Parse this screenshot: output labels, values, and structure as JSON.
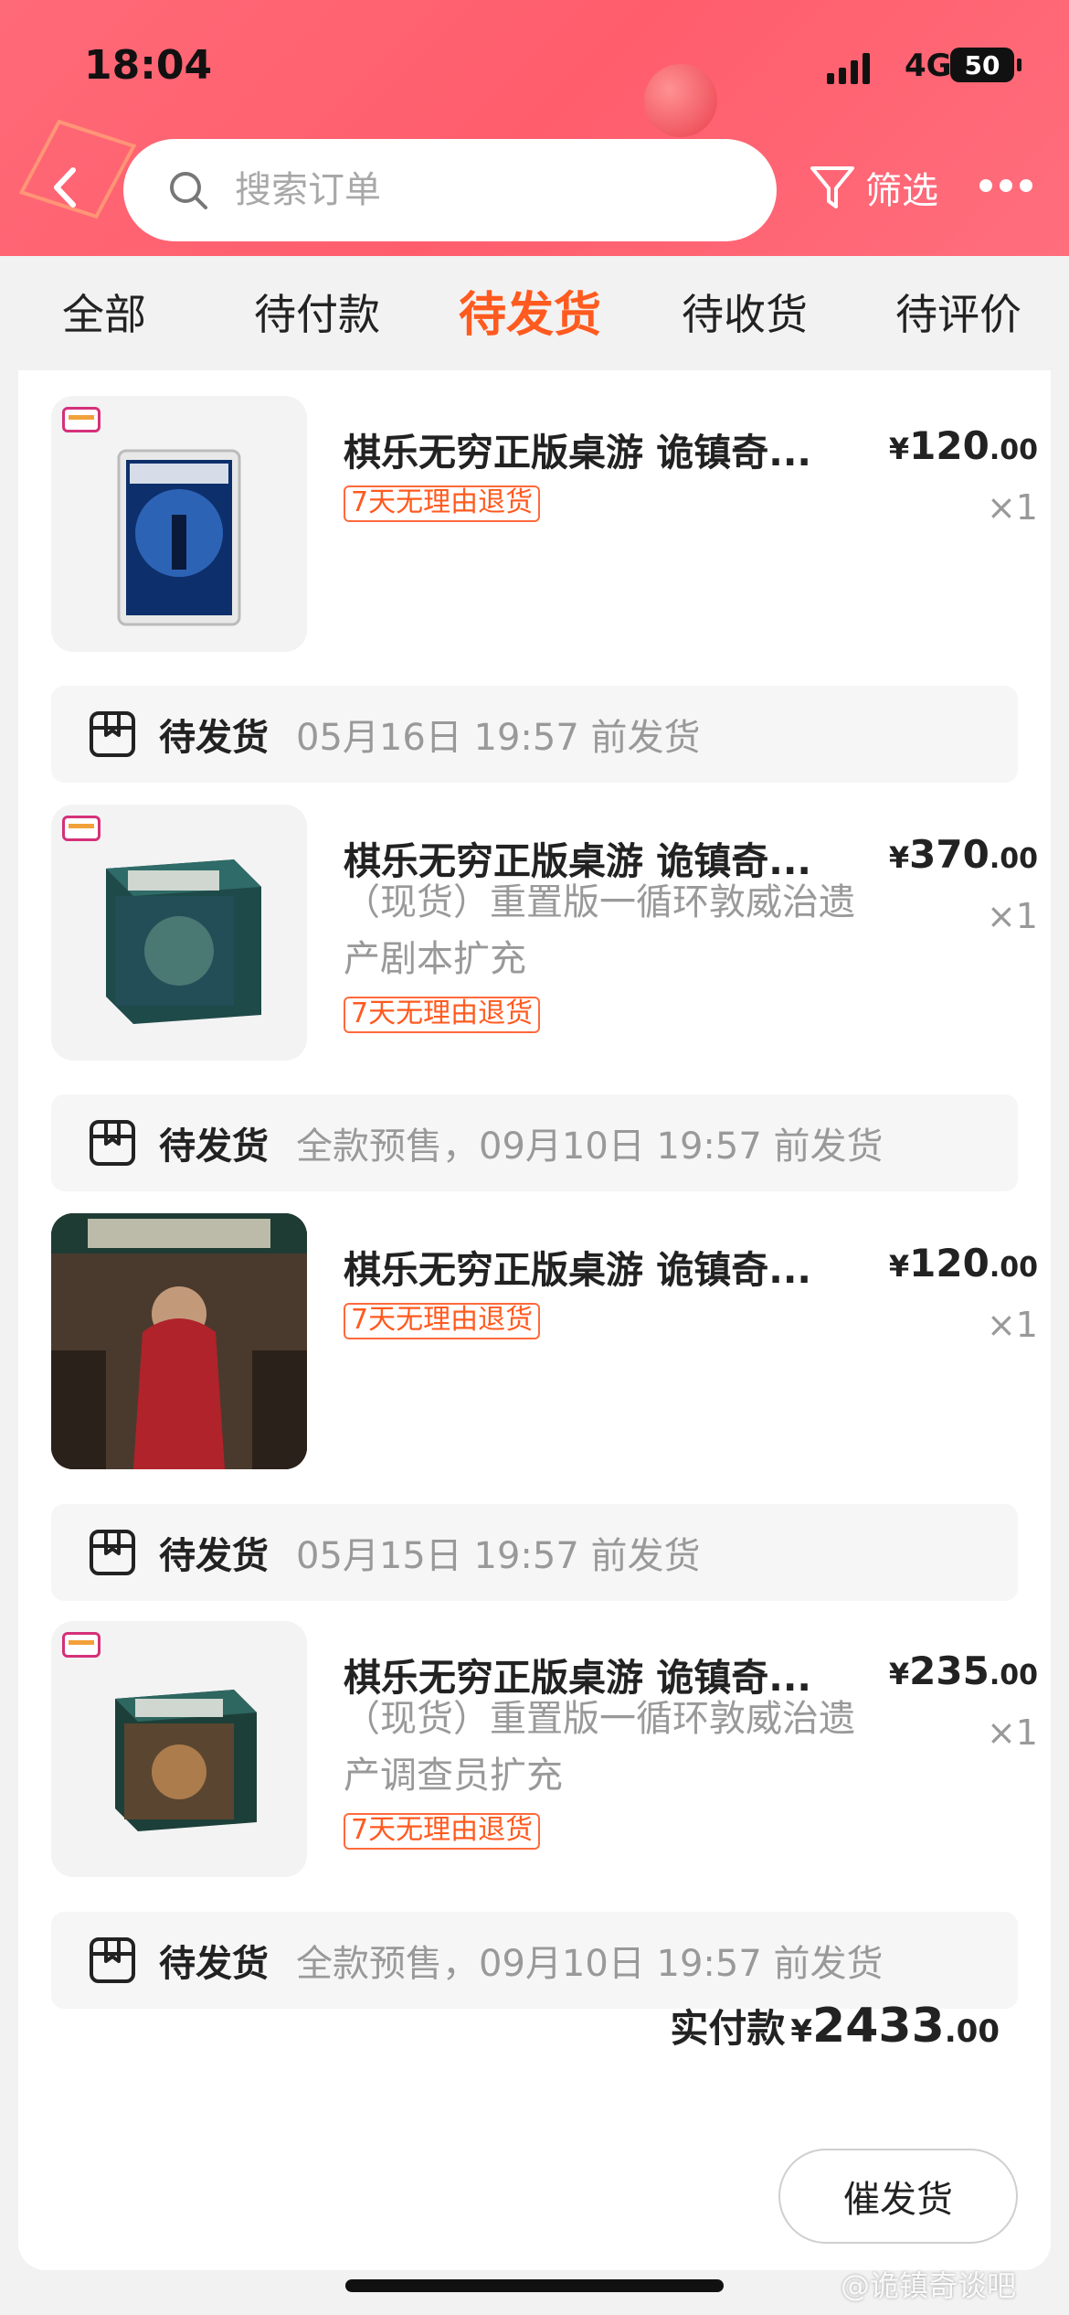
{
  "status_bar": {
    "time": "18:04",
    "network": "4G",
    "battery": "50"
  },
  "header": {
    "search_placeholder": "搜索订单",
    "filter_label": "筛选"
  },
  "tabs": [
    {
      "label": "全部"
    },
    {
      "label": "待付款"
    },
    {
      "label": "待发货",
      "active": true
    },
    {
      "label": "待收货"
    },
    {
      "label": "待评价"
    }
  ],
  "orders": [
    {
      "title": "棋乐无穷正版桌游 诡镇奇...",
      "price_currency": "¥",
      "price_int": "120",
      "price_dec": ".00",
      "qty": "×1",
      "spec": "",
      "badge": "7天无理由退货",
      "ship_status": "待发货",
      "ship_time": "05月16日 19:57 前发货"
    },
    {
      "title": "棋乐无穷正版桌游 诡镇奇...",
      "price_currency": "¥",
      "price_int": "370",
      "price_dec": ".00",
      "qty": "×1",
      "spec": "（现货）重置版一循环敦威治遗产剧本扩充",
      "badge": "7天无理由退货",
      "ship_status": "待发货",
      "ship_time": "全款预售，09月10日 19:57 前发货"
    },
    {
      "title": "棋乐无穷正版桌游 诡镇奇...",
      "price_currency": "¥",
      "price_int": "120",
      "price_dec": ".00",
      "qty": "×1",
      "spec": "",
      "badge": "7天无理由退货",
      "ship_status": "待发货",
      "ship_time": "05月15日 19:57 前发货"
    },
    {
      "title": "棋乐无穷正版桌游 诡镇奇...",
      "price_currency": "¥",
      "price_int": "235",
      "price_dec": ".00",
      "qty": "×1",
      "spec": "（现货）重置版一循环敦威治遗产调查员扩充",
      "badge": "7天无理由退货",
      "ship_status": "待发货",
      "ship_time": "全款预售，09月10日 19:57 前发货"
    }
  ],
  "total": {
    "label": "实付款",
    "currency": "¥",
    "int": "2433",
    "dec": ".00"
  },
  "urge_button_label": "催发货",
  "watermark": "@诡镇奇谈吧",
  "colors": {
    "header_bg": "#ff5d6c",
    "accent": "#ff5a1f"
  }
}
